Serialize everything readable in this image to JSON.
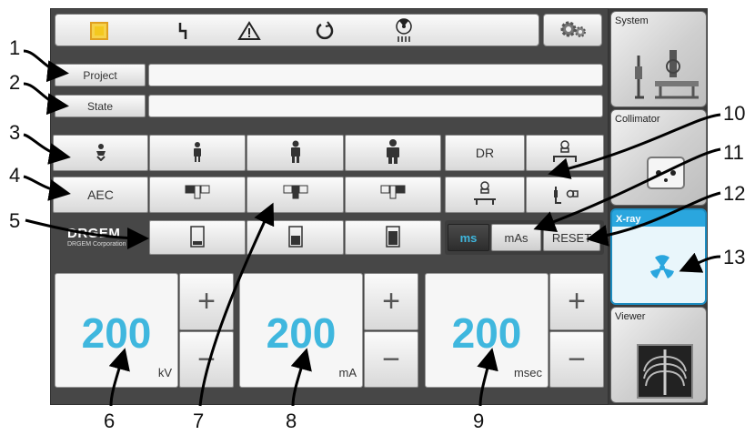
{
  "header": {
    "status_icons": [
      "square-indicator-icon",
      "lightning-icon",
      "warning-triangle-icon",
      "power-icon",
      "radiation-icon"
    ],
    "settings_icon": "gear-icon"
  },
  "info": {
    "project_label": "Project",
    "project_value": "",
    "state_label": "State",
    "state_value": ""
  },
  "patient_row": {
    "icons": [
      "child-patient-icon",
      "small-patient-icon",
      "medium-patient-icon",
      "large-patient-icon"
    ]
  },
  "aec_row": {
    "aec_label": "AEC",
    "field_icons": [
      "aec-field-left-icon",
      "aec-field-center-icon",
      "aec-field-right-icon"
    ]
  },
  "density_row": {
    "logo_text": "DRGEM",
    "logo_subtext": "DRGEM Corporation",
    "icons": [
      "density-low-icon",
      "density-mid-icon",
      "density-high-icon"
    ]
  },
  "detector": {
    "dr_label": "DR",
    "icons": [
      "table-tube-icon",
      "table-detector-icon",
      "wall-stand-icon"
    ]
  },
  "mode": {
    "ms_label": "ms",
    "mas_label": "mAs",
    "reset_label": "RESET"
  },
  "params": {
    "kv": {
      "value": "200",
      "unit": "kV"
    },
    "ma": {
      "value": "200",
      "unit": "mA"
    },
    "msec": {
      "value": "200",
      "unit": "msec"
    },
    "plus": "+",
    "minus": "−"
  },
  "sidebar": {
    "items": [
      {
        "label": "System"
      },
      {
        "label": "Collimator"
      },
      {
        "label": "X-ray"
      },
      {
        "label": "Viewer"
      }
    ]
  },
  "callouts": [
    "1",
    "2",
    "3",
    "4",
    "5",
    "6",
    "7",
    "8",
    "9",
    "10",
    "11",
    "12",
    "13"
  ]
}
